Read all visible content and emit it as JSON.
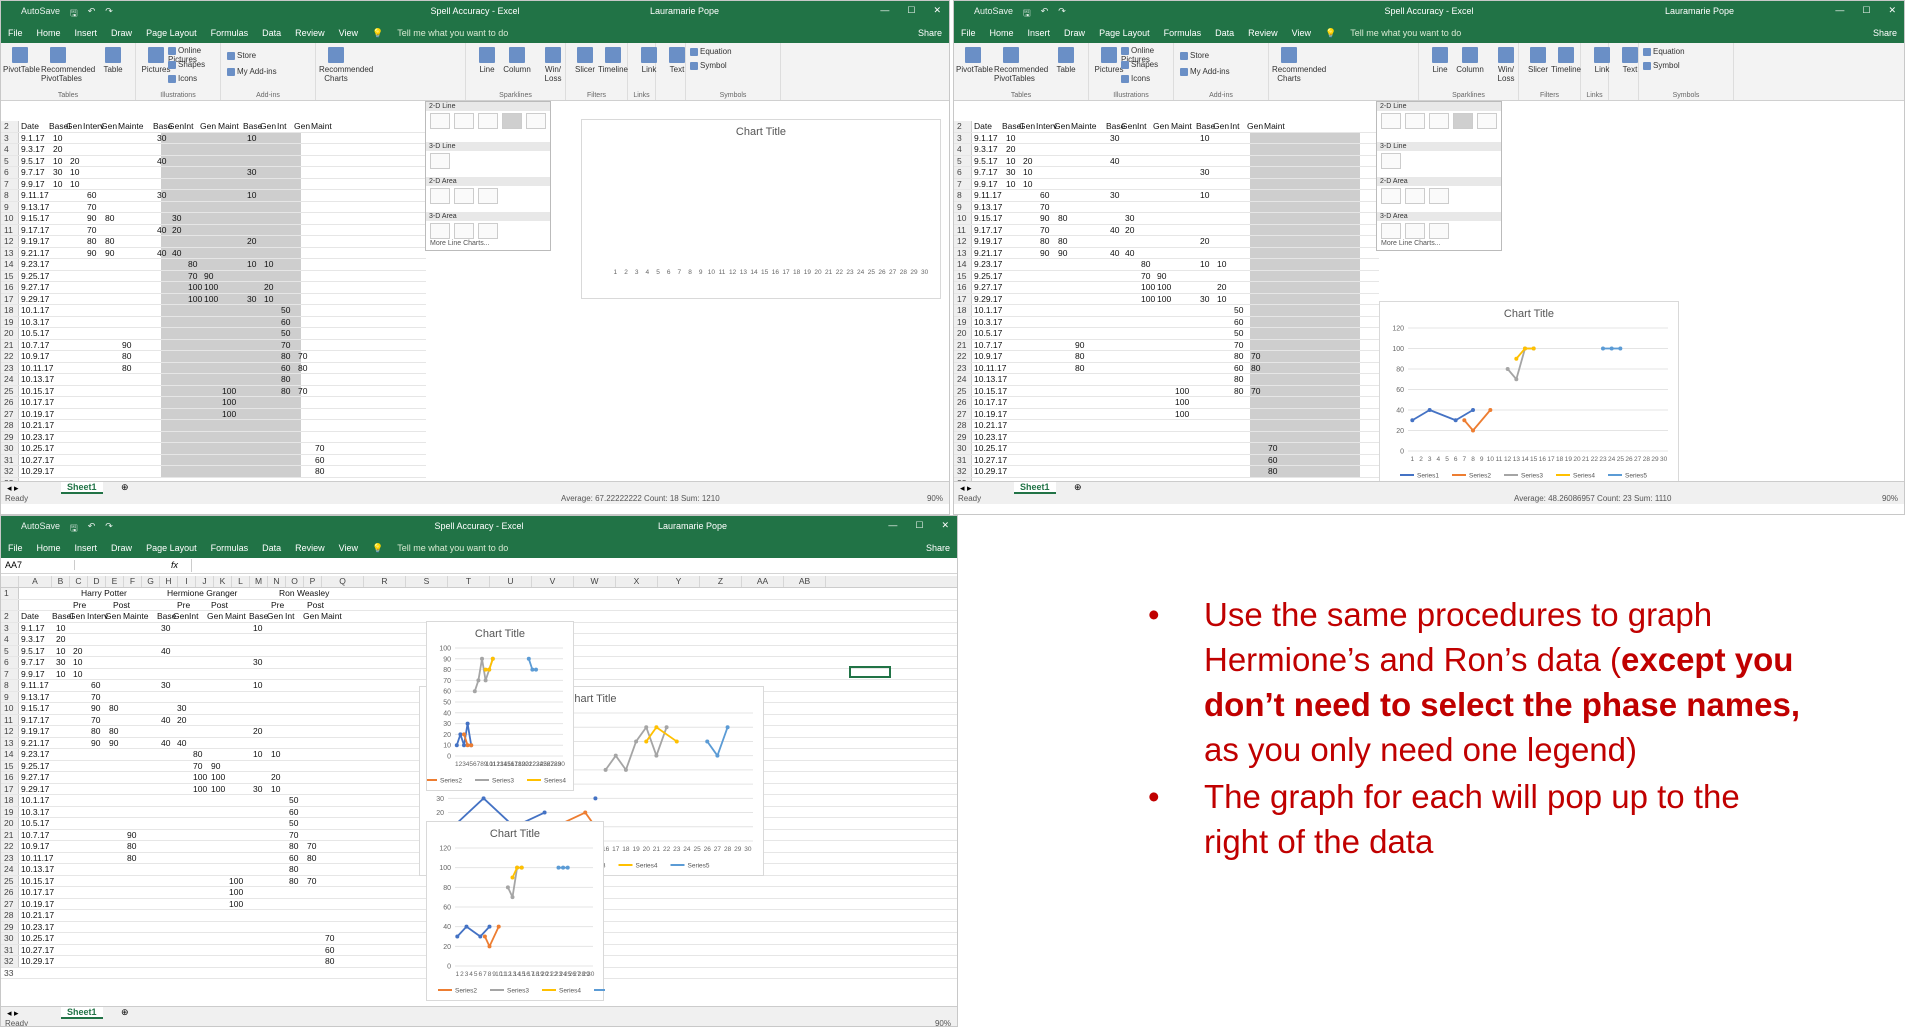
{
  "excel": {
    "title": "Spell Accuracy  -  Excel",
    "user": "Lauramarie Pope",
    "autosave": "AutoSave",
    "menus": [
      "File",
      "Home",
      "Insert",
      "Draw",
      "Page Layout",
      "Formulas",
      "Data",
      "Review",
      "View"
    ],
    "tell_me": "Tell me what you want to do",
    "share": "Share",
    "ribbon": {
      "pivottable": "PivotTable",
      "recommended_pivot": "Recommended PivotTables",
      "table": "Table",
      "tables_group": "Tables",
      "pictures": "Pictures",
      "online_pictures": "Online Pictures",
      "shapes": "Shapes",
      "icons": "Icons",
      "illustrations_group": "Illustrations",
      "store": "Store",
      "my_addins": "My Add-ins",
      "addins_group": "Add-ins",
      "recommended_charts": "Recommended Charts",
      "line": "Line",
      "column": "Column",
      "winloss": "Win/ Loss",
      "sparklines_group": "Sparklines",
      "slicer": "Slicer",
      "timeline": "Timeline",
      "filters_group": "Filters",
      "link": "Link",
      "links_group": "Links",
      "text": "Text",
      "equation": "Equation",
      "symbol": "Symbol",
      "symbols_group": "Symbols"
    },
    "namebox": "AA7",
    "fx": "fx",
    "sheet_tab": "Sheet1",
    "ready": "Ready",
    "status_1": "Average: 67.22222222   Count: 18   Sum: 1210",
    "status_2": "Average: 48.26086957   Count: 23   Sum: 1110",
    "zoom": "90%",
    "columns": [
      "A",
      "B",
      "C",
      "D",
      "E",
      "F",
      "G",
      "H",
      "I",
      "J",
      "K",
      "L",
      "M",
      "N",
      "O",
      "P",
      "Q",
      "R",
      "S",
      "T",
      "U",
      "V",
      "W",
      "X",
      "Y",
      "Z",
      "AA",
      "AB"
    ],
    "group_headers": {
      "harry": "Harry Potter",
      "hermione": "Hermione Granger",
      "ron": "Ron Weasley",
      "pre": "Pre",
      "post": "Post"
    },
    "row2": [
      "Date",
      "Basel",
      "Gen",
      "Interv",
      "Gen",
      "Mainte",
      "Base",
      "Gen",
      "Int",
      "Gen",
      "Maint",
      "Base",
      "Gen",
      "Int",
      "Gen",
      "Maint"
    ],
    "rows": [
      {
        "n": "3",
        "date": "9.1.17",
        "v": {
          "B": "10",
          "G": "30",
          "L": "10"
        }
      },
      {
        "n": "4",
        "date": "9.3.17",
        "v": {
          "B": "20"
        }
      },
      {
        "n": "5",
        "date": "9.5.17",
        "v": {
          "B": "10",
          "C": "20",
          "G": "40"
        }
      },
      {
        "n": "6",
        "date": "9.7.17",
        "v": {
          "B": "30",
          "C": "10",
          "L": "30"
        }
      },
      {
        "n": "7",
        "date": "9.9.17",
        "v": {
          "B": "10",
          "C": "10"
        }
      },
      {
        "n": "8",
        "date": "9.11.17",
        "v": {
          "D": "60",
          "G": "30",
          "L": "10"
        }
      },
      {
        "n": "9",
        "date": "9.13.17",
        "v": {
          "D": "70"
        }
      },
      {
        "n": "10",
        "date": "9.15.17",
        "v": {
          "D": "90",
          "E": "80",
          "H": "30"
        }
      },
      {
        "n": "11",
        "date": "9.17.17",
        "v": {
          "D": "70",
          "G": "40",
          "H": "20"
        }
      },
      {
        "n": "12",
        "date": "9.19.17",
        "v": {
          "D": "80",
          "E": "80",
          "L": "20"
        }
      },
      {
        "n": "13",
        "date": "9.21.17",
        "v": {
          "D": "90",
          "E": "90",
          "G": "40",
          "H": "40"
        }
      },
      {
        "n": "14",
        "date": "9.23.17",
        "v": {
          "I": "80",
          "L": "10",
          "M": "10"
        }
      },
      {
        "n": "15",
        "date": "9.25.17",
        "v": {
          "I": "70",
          "J": "90"
        }
      },
      {
        "n": "16",
        "date": "9.27.17",
        "v": {
          "I": "100",
          "J": "100",
          "M": "20"
        }
      },
      {
        "n": "17",
        "date": "9.29.17",
        "v": {
          "I": "100",
          "J": "100",
          "L": "30",
          "M": "10"
        }
      },
      {
        "n": "18",
        "date": "10.1.17",
        "v": {
          "N": "50"
        }
      },
      {
        "n": "19",
        "date": "10.3.17",
        "v": {
          "N": "60"
        }
      },
      {
        "n": "20",
        "date": "10.5.17",
        "v": {
          "N": "50"
        }
      },
      {
        "n": "21",
        "date": "10.7.17",
        "v": {
          "F": "90",
          "N": "70"
        }
      },
      {
        "n": "22",
        "date": "10.9.17",
        "v": {
          "F": "80",
          "N": "80",
          "O": "70"
        }
      },
      {
        "n": "23",
        "date": "10.11.17",
        "v": {
          "F": "80",
          "N": "60",
          "O": "80"
        }
      },
      {
        "n": "24",
        "date": "10.13.17",
        "v": {
          "N": "80"
        }
      },
      {
        "n": "25",
        "date": "10.15.17",
        "v": {
          "K": "100",
          "N": "80",
          "O": "70"
        }
      },
      {
        "n": "26",
        "date": "10.17.17",
        "v": {
          "K": "100"
        }
      },
      {
        "n": "27",
        "date": "10.19.17",
        "v": {
          "K": "100"
        }
      },
      {
        "n": "28",
        "date": "10.21.17",
        "v": {}
      },
      {
        "n": "29",
        "date": "10.23.17",
        "v": {}
      },
      {
        "n": "30",
        "date": "10.25.17",
        "v": {
          "P": "70"
        }
      },
      {
        "n": "31",
        "date": "10.27.17",
        "v": {
          "P": "60"
        }
      },
      {
        "n": "32",
        "date": "10.29.17",
        "v": {
          "P": "80"
        }
      },
      {
        "n": "33",
        "date": "",
        "v": {}
      }
    ],
    "gallery": {
      "sec1": "2-D Line",
      "sec2": "3-D Line",
      "sec3": "2-D Area",
      "sec4": "3-D Area",
      "more": "More Line Charts..."
    }
  },
  "chart_data": [
    {
      "type": "line",
      "title": "Chart Title",
      "x": [
        "1",
        "2",
        "3",
        "4",
        "5",
        "6",
        "7",
        "8",
        "9",
        "10",
        "11",
        "12",
        "13",
        "14",
        "15",
        "16",
        "17",
        "18",
        "19",
        "20",
        "21",
        "22",
        "23",
        "24",
        "25",
        "26",
        "27",
        "28",
        "29",
        "30"
      ],
      "ylim": [
        0,
        120
      ],
      "yticks": [
        "0",
        "20",
        "40",
        "60",
        "80",
        "100",
        "120"
      ],
      "series": [
        {
          "name": "Series1",
          "color": "#4472c4",
          "points": [
            [
              1,
              30
            ],
            [
              3,
              40
            ],
            [
              6,
              30
            ],
            [
              8,
              40
            ]
          ]
        },
        {
          "name": "Series2",
          "color": "#ed7d31",
          "points": [
            [
              7,
              30
            ],
            [
              8,
              20
            ],
            [
              10,
              40
            ]
          ]
        },
        {
          "name": "Series3",
          "color": "#a5a5a5",
          "points": [
            [
              12,
              80
            ],
            [
              13,
              70
            ],
            [
              14,
              100
            ],
            [
              15,
              100
            ]
          ]
        },
        {
          "name": "Series4",
          "color": "#ffc000",
          "points": [
            [
              13,
              90
            ],
            [
              14,
              100
            ],
            [
              15,
              100
            ]
          ]
        },
        {
          "name": "Series5",
          "color": "#5b9bd5",
          "points": [
            [
              23,
              100
            ],
            [
              24,
              100
            ],
            [
              25,
              100
            ]
          ]
        }
      ]
    },
    {
      "type": "line",
      "title": "Chart Title",
      "x": [
        "1",
        "2",
        "3",
        "4",
        "5",
        "6",
        "7",
        "8",
        "9",
        "10",
        "11",
        "12",
        "13",
        "14",
        "15",
        "16",
        "17",
        "18",
        "19",
        "20",
        "21",
        "22",
        "23",
        "24",
        "25",
        "26",
        "27",
        "28",
        "29",
        "30"
      ],
      "ylim": [
        0,
        100
      ],
      "yticks": [
        "0",
        "10",
        "20",
        "30",
        "40",
        "50",
        "60",
        "70",
        "80",
        "90",
        "100"
      ],
      "series": [
        {
          "name": "Series1",
          "color": "#4472c4",
          "points": [
            [
              1,
              10
            ],
            [
              2,
              20
            ],
            [
              3,
              10
            ],
            [
              4,
              30
            ],
            [
              5,
              10
            ]
          ]
        },
        {
          "name": "Series2",
          "color": "#ed7d31",
          "points": [
            [
              3,
              20
            ],
            [
              4,
              10
            ],
            [
              5,
              10
            ]
          ]
        },
        {
          "name": "Series3",
          "color": "#a5a5a5",
          "points": [
            [
              6,
              60
            ],
            [
              7,
              70
            ],
            [
              8,
              90
            ],
            [
              9,
              70
            ],
            [
              10,
              80
            ],
            [
              11,
              90
            ]
          ]
        },
        {
          "name": "Series4",
          "color": "#ffc000",
          "points": [
            [
              9,
              80
            ],
            [
              10,
              80
            ],
            [
              11,
              90
            ]
          ]
        },
        {
          "name": "Series5",
          "color": "#5b9bd5",
          "points": [
            [
              21,
              90
            ],
            [
              22,
              80
            ],
            [
              23,
              80
            ]
          ]
        }
      ]
    },
    {
      "type": "line",
      "title": "Chart Title",
      "x": [
        "1",
        "2",
        "3",
        "4",
        "5",
        "6",
        "7",
        "8",
        "9",
        "10",
        "11",
        "12",
        "13",
        "14",
        "15",
        "16",
        "17",
        "18",
        "19",
        "20",
        "21",
        "22",
        "23",
        "24",
        "25",
        "26",
        "27",
        "28",
        "29",
        "30"
      ],
      "ylim": [
        0,
        90
      ],
      "yticks": [
        "0",
        "10",
        "20",
        "30",
        "40",
        "50",
        "60",
        "70",
        "80",
        "90"
      ],
      "series": [
        {
          "name": "Series1",
          "color": "#4472c4",
          "points": [
            [
              1,
              10
            ],
            [
              4,
              30
            ],
            [
              7,
              10
            ],
            [
              10,
              20
            ],
            [
              15,
              30
            ]
          ]
        },
        {
          "name": "Series2",
          "color": "#ed7d31",
          "points": [
            [
              11,
              10
            ],
            [
              14,
              20
            ],
            [
              15,
              10
            ]
          ]
        },
        {
          "name": "Series3",
          "color": "#a5a5a5",
          "points": [
            [
              16,
              50
            ],
            [
              17,
              60
            ],
            [
              18,
              50
            ],
            [
              19,
              70
            ],
            [
              20,
              80
            ],
            [
              21,
              60
            ],
            [
              22,
              80
            ]
          ]
        },
        {
          "name": "Series4",
          "color": "#ffc000",
          "points": [
            [
              20,
              70
            ],
            [
              21,
              80
            ],
            [
              23,
              70
            ]
          ]
        },
        {
          "name": "Series5",
          "color": "#5b9bd5",
          "points": [
            [
              26,
              70
            ],
            [
              27,
              60
            ],
            [
              28,
              80
            ]
          ]
        }
      ]
    }
  ],
  "bullets": {
    "b1_pre": "Use the same procedures to graph Hermione’s and Ron’s data (",
    "b1_bold": "except you don’t need to select the phase names,",
    "b1_post": " as you only need one legend)",
    "b2": "The graph for each will pop up to the right of the data",
    "bullet_char": "•"
  }
}
